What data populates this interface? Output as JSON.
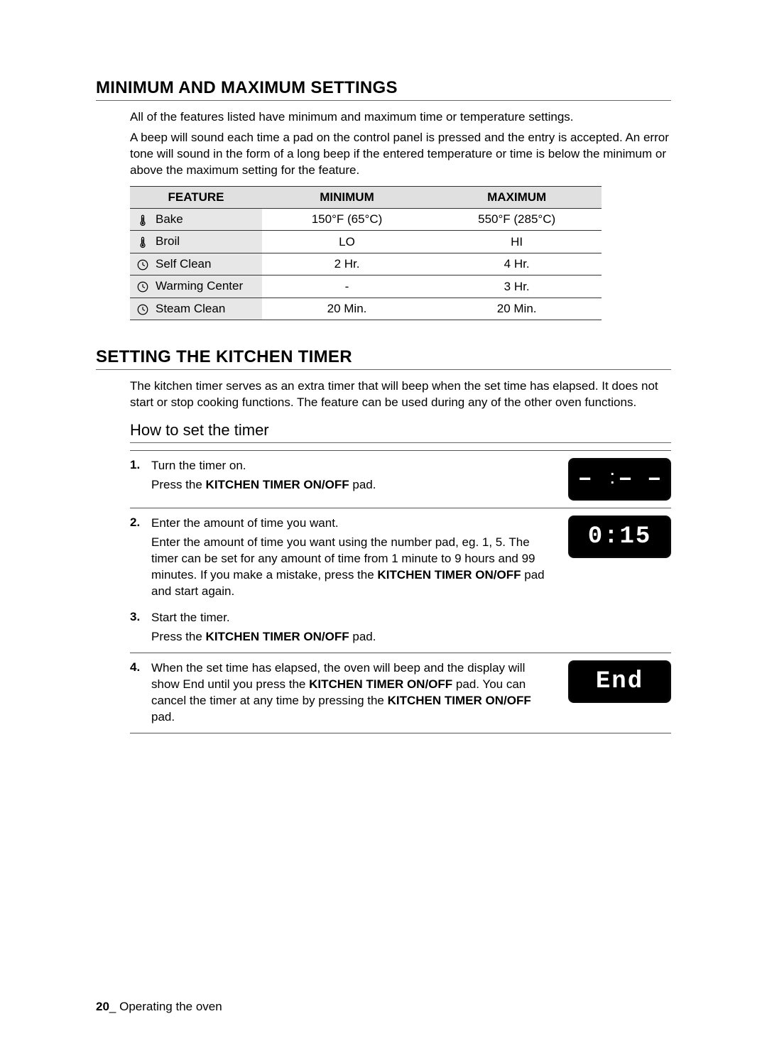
{
  "section1": {
    "heading": "MINIMUM AND MAXIMUM SETTINGS",
    "para1": "All of the features listed have minimum and maximum time or temperature settings.",
    "para2": "A beep will sound each time a pad on the control panel is pressed and the entry is accepted. An error tone will sound in the form of a long beep if the entered temperature or time is below the minimum or above the maximum setting for the feature.",
    "table": {
      "headers": {
        "feature": "FEATURE",
        "min": "MINIMUM",
        "max": "MAXIMUM"
      },
      "rows": [
        {
          "icon": "thermometer",
          "feature": "Bake",
          "min": "150°F (65°C)",
          "max": "550°F (285°C)"
        },
        {
          "icon": "thermometer",
          "feature": "Broil",
          "min": "LO",
          "max": "HI"
        },
        {
          "icon": "clock",
          "feature": "Self Clean",
          "min": "2 Hr.",
          "max": "4 Hr."
        },
        {
          "icon": "clock",
          "feature": "Warming Center",
          "min": "-",
          "max": "3 Hr."
        },
        {
          "icon": "clock",
          "feature": "Steam Clean",
          "min": "20 Min.",
          "max": "20 Min."
        }
      ]
    }
  },
  "section2": {
    "heading": "SETTING THE KITCHEN TIMER",
    "para": "The kitchen timer serves as an extra timer that will beep when the set time has elapsed. It does not start or stop cooking functions. The feature can be used during any of the other oven functions.",
    "subheading": "How to set the timer",
    "steps": [
      {
        "num": "1",
        "title": "Turn the timer on.",
        "detail_pre": "Press the ",
        "detail_bold": "KITCHEN TIMER ON/OFF",
        "detail_post": " pad.",
        "display": "dashes"
      },
      {
        "num": "2",
        "title": "Enter the amount of time you want.",
        "detail_pre": "Enter the amount of time you want using the number pad, eg. 1, 5. The timer can be set for any amount of time from 1 minute to 9 hours and 99 minutes. If you make a mistake, press the ",
        "detail_bold": "KITCHEN TIMER ON/OFF",
        "detail_post": " pad and start again.",
        "display": "0:15"
      },
      {
        "num": "3",
        "title": "Start the timer.",
        "detail_pre": "Press the ",
        "detail_bold": "KITCHEN TIMER ON/OFF",
        "detail_post": " pad.",
        "display": null
      },
      {
        "num": "4",
        "title_pre": "When the set time has elapsed, the oven will beep and the display will show End until you press the ",
        "title_bold1": "KITCHEN TIMER ON/OFF",
        "title_mid": " pad. You can cancel the timer at any time by pressing the ",
        "title_bold2": "KITCHEN TIMER ON/OFF",
        "title_post": " pad.",
        "display": "End"
      }
    ]
  },
  "footer": {
    "page": "20",
    "label": "_ Operating the oven"
  }
}
